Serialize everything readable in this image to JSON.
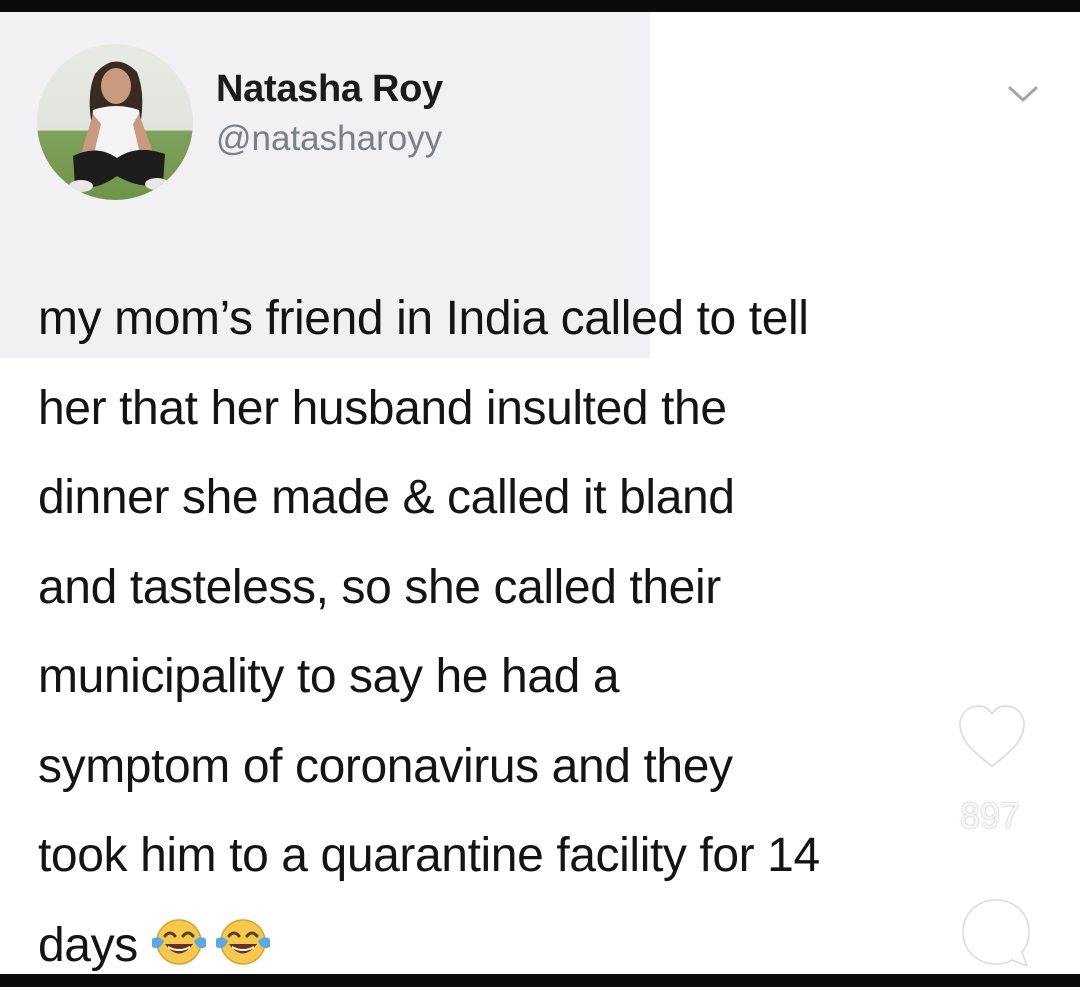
{
  "tweet": {
    "author": {
      "display_name": "Natasha Roy",
      "handle": "@natasharoyy"
    },
    "text_lines": [
      "my mom’s friend in India called to tell",
      "her that her husband insulted the",
      "dinner she made & called it bland",
      "and tasteless, so she called their",
      "municipality to say he had a",
      "symptom of coronavirus and they",
      "took him to a quarantine facility for 14",
      "days"
    ],
    "emojis": [
      "face-with-tears-of-joy",
      "face-with-tears-of-joy"
    ],
    "menu_icon": "chevron-down-icon"
  },
  "overlay": {
    "like_count": "897",
    "like_icon": "heart-outline-icon",
    "comment_icon": "comment-bubble-icon"
  },
  "colors": {
    "text": "#141414",
    "handle": "#7b7f86",
    "header_tint": "#f1f1f3",
    "emoji_face": "#f6c94a",
    "tears": "#5aa9e6"
  }
}
